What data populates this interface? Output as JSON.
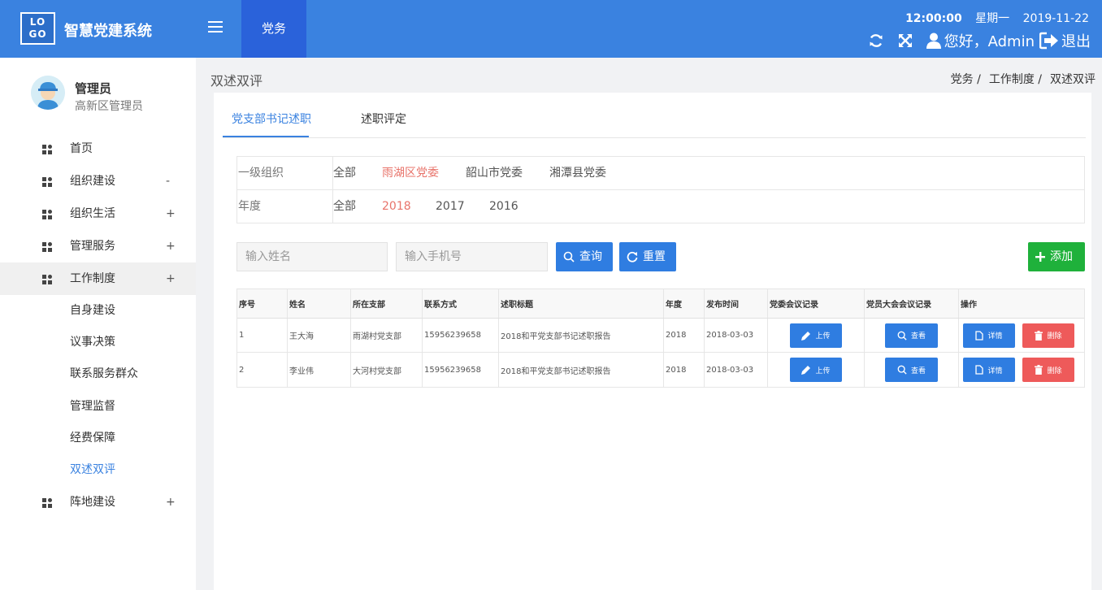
{
  "header": {
    "logo_text": "LO GO",
    "app_title": "智慧党建系统",
    "top_tab": "党务",
    "time": "12:00:00",
    "weekday": "星期一",
    "date": "2019-11-22",
    "greeting": "您好，Admin",
    "logout": "退出"
  },
  "profile": {
    "name": "管理员",
    "role": "高新区管理员"
  },
  "menu": [
    {
      "label": "首页",
      "toggle": ""
    },
    {
      "label": "组织建设",
      "toggle": "-"
    },
    {
      "label": "组织生活",
      "toggle": "+"
    },
    {
      "label": "管理服务",
      "toggle": "+"
    },
    {
      "label": "工作制度",
      "toggle": "+"
    },
    {
      "label": "阵地建设",
      "toggle": "+"
    }
  ],
  "submenu": [
    "自身建设",
    "议事决策",
    "联系服务群众",
    "管理监督",
    "经费保障",
    "双述双评"
  ],
  "page": {
    "title": "双述双评",
    "breadcrumb": [
      "党务 /",
      "工作制度 /",
      "双述双评"
    ]
  },
  "tabs": [
    "党支部书记述职",
    "述职评定"
  ],
  "filters": {
    "org_label": "一级组织",
    "org_options": [
      "全部",
      "雨湖区党委",
      "韶山市党委",
      "湘潭县党委"
    ],
    "year_label": "年度",
    "year_options": [
      "全部",
      "2018",
      "2017",
      "2016"
    ]
  },
  "search": {
    "name_placeholder": "输入姓名",
    "phone_placeholder": "输入手机号",
    "query": "查询",
    "reset": "重置",
    "add": "添加"
  },
  "table": {
    "headers": [
      "序号",
      "姓名",
      "所在支部",
      "联系方式",
      "述职标题",
      "年度",
      "发布时间",
      "党委会议记录",
      "党员大会会议记录",
      "操作"
    ],
    "rows": [
      {
        "no": "1",
        "name": "王大海",
        "branch": "雨湖村党支部",
        "phone": "15956239658",
        "title": "2018和平党支部书记述职报告",
        "year": "2018",
        "date": "2018-03-03"
      },
      {
        "no": "2",
        "name": "李业伟",
        "branch": "大河村党支部",
        "phone": "15956239658",
        "title": "2018和平党支部书记述职报告",
        "year": "2018",
        "date": "2018-03-03"
      }
    ],
    "upload": "上传",
    "view": "查看",
    "detail": "详情",
    "delete": "删除"
  },
  "colors": {
    "primary": "#3a82e0",
    "header_tab": "#2a62da",
    "selected": "#e8736a",
    "add": "#1fb13b",
    "delete": "#ee5a5a"
  }
}
